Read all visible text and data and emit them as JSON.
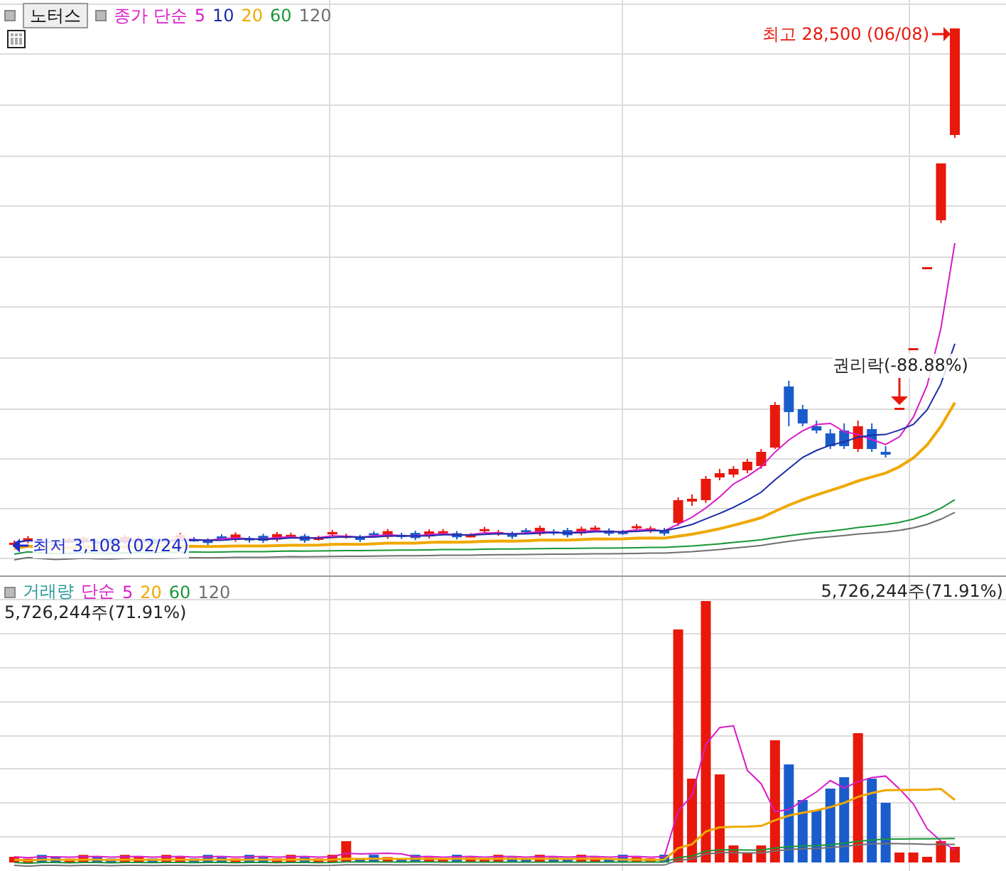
{
  "price_panel": {
    "stock_button": "노터스",
    "ma_type": "종가 단순",
    "ma_periods": [
      {
        "label": "5",
        "color": "#d81cc8"
      },
      {
        "label": "10",
        "color": "#1a2ca8"
      },
      {
        "label": "20",
        "color": "#f0a800"
      },
      {
        "label": "60",
        "color": "#1a9638"
      },
      {
        "label": "120",
        "color": "#707070"
      }
    ],
    "high_label": "최고 28,500 (06/08)",
    "ex_rights_label": "권리락(-88.88%)",
    "low_label": "최저 3,108 (02/24)"
  },
  "volume_panel": {
    "title": "거래량",
    "ma_type": "단순",
    "ma_periods": [
      {
        "label": "5",
        "color": "#d81cc8"
      },
      {
        "label": "20",
        "color": "#f0a800"
      },
      {
        "label": "60",
        "color": "#1a9638"
      },
      {
        "label": "120",
        "color": "#707070"
      }
    ],
    "value_right": "5,726,244주(71.91%)",
    "value_left": "5,726,244주(71.91%)"
  }
}
